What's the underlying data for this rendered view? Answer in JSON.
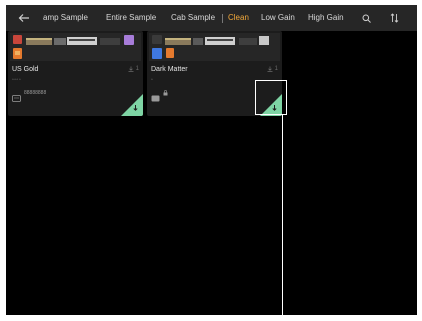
{
  "topbar": {
    "tabs": [
      {
        "label": "amp Sample"
      },
      {
        "label": "Entire Sample"
      },
      {
        "label": "Cab Sample"
      },
      {
        "label": "Clean"
      },
      {
        "label": "Low Gain"
      },
      {
        "label": "High Gain"
      }
    ],
    "active_tab": "Clean",
    "icons": {
      "back": "back-arrow-icon",
      "search": "search-icon",
      "sort": "sort-icon"
    }
  },
  "presets": [
    {
      "name": "US Gold",
      "subtitle": "▫▫▫▫",
      "meta": "88888888",
      "downloads": "1"
    },
    {
      "name": "Dark Matter",
      "subtitle": "▫",
      "meta": "",
      "downloads": "1"
    }
  ],
  "colors": {
    "accent": "#f2a93b",
    "corner_badge": "#7ed4a4",
    "card_bg": "#1c1c1c",
    "topbar_bg": "#262626"
  }
}
